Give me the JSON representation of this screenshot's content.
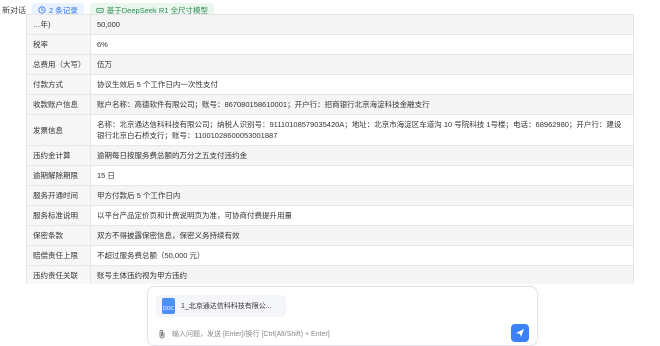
{
  "topbar": {
    "title": "新对话",
    "records_label": "2 条记录",
    "model_label": "基于DeepSeek R1 全尺寸模型"
  },
  "table": {
    "rows": [
      {
        "key": "…年)",
        "value": "50,000"
      },
      {
        "key": "税率",
        "value": "6%"
      },
      {
        "key": "总费用（大写）",
        "value": "伍万"
      },
      {
        "key": "付款方式",
        "value": "协议生效后 5 个工作日内一次性支付"
      },
      {
        "key": "收款账户信息",
        "value": "账户名称：高德软件有限公司；账号：867080158610001；开户行：招商银行北京海淀科技金融支行"
      },
      {
        "key": "发票信息",
        "value": "名称：北京通达信科科技有限公司；纳税人识别号：91110108579035420A；地址：北京市海淀区车道沟 10 号院科技 1号楼；电话：68962980；开户行：建设银行北京白石桥支行；账号：11001028600053001887"
      },
      {
        "key": "违约金计算",
        "value": "逾期每日按服务费总额的万分之五支付违约金"
      },
      {
        "key": "逾期解除期限",
        "value": "15 日"
      },
      {
        "key": "服务开通时间",
        "value": "甲方付款后 5 个工作日内"
      },
      {
        "key": "服务标准说明",
        "value": "以平台产品定价页和计费说明页为准，可协商付费提升用量"
      },
      {
        "key": "保密条款",
        "value": "双方不得披露保密信息，保密义务持续有效"
      },
      {
        "key": "赔偿责任上限",
        "value": "不超过服务费总额（50,000 元）"
      },
      {
        "key": "违约责任关联",
        "value": "账号主体违约视为甲方违约"
      },
      {
        "key": "…",
        "value": "…"
      }
    ]
  },
  "composer": {
    "file_name": "1_北京通达信科科技有限公...",
    "file_type": "DOC",
    "placeholder": "输入问题，发送 [Enter]/换行 [Ctrl(Alt/Shift) + Enter]"
  }
}
